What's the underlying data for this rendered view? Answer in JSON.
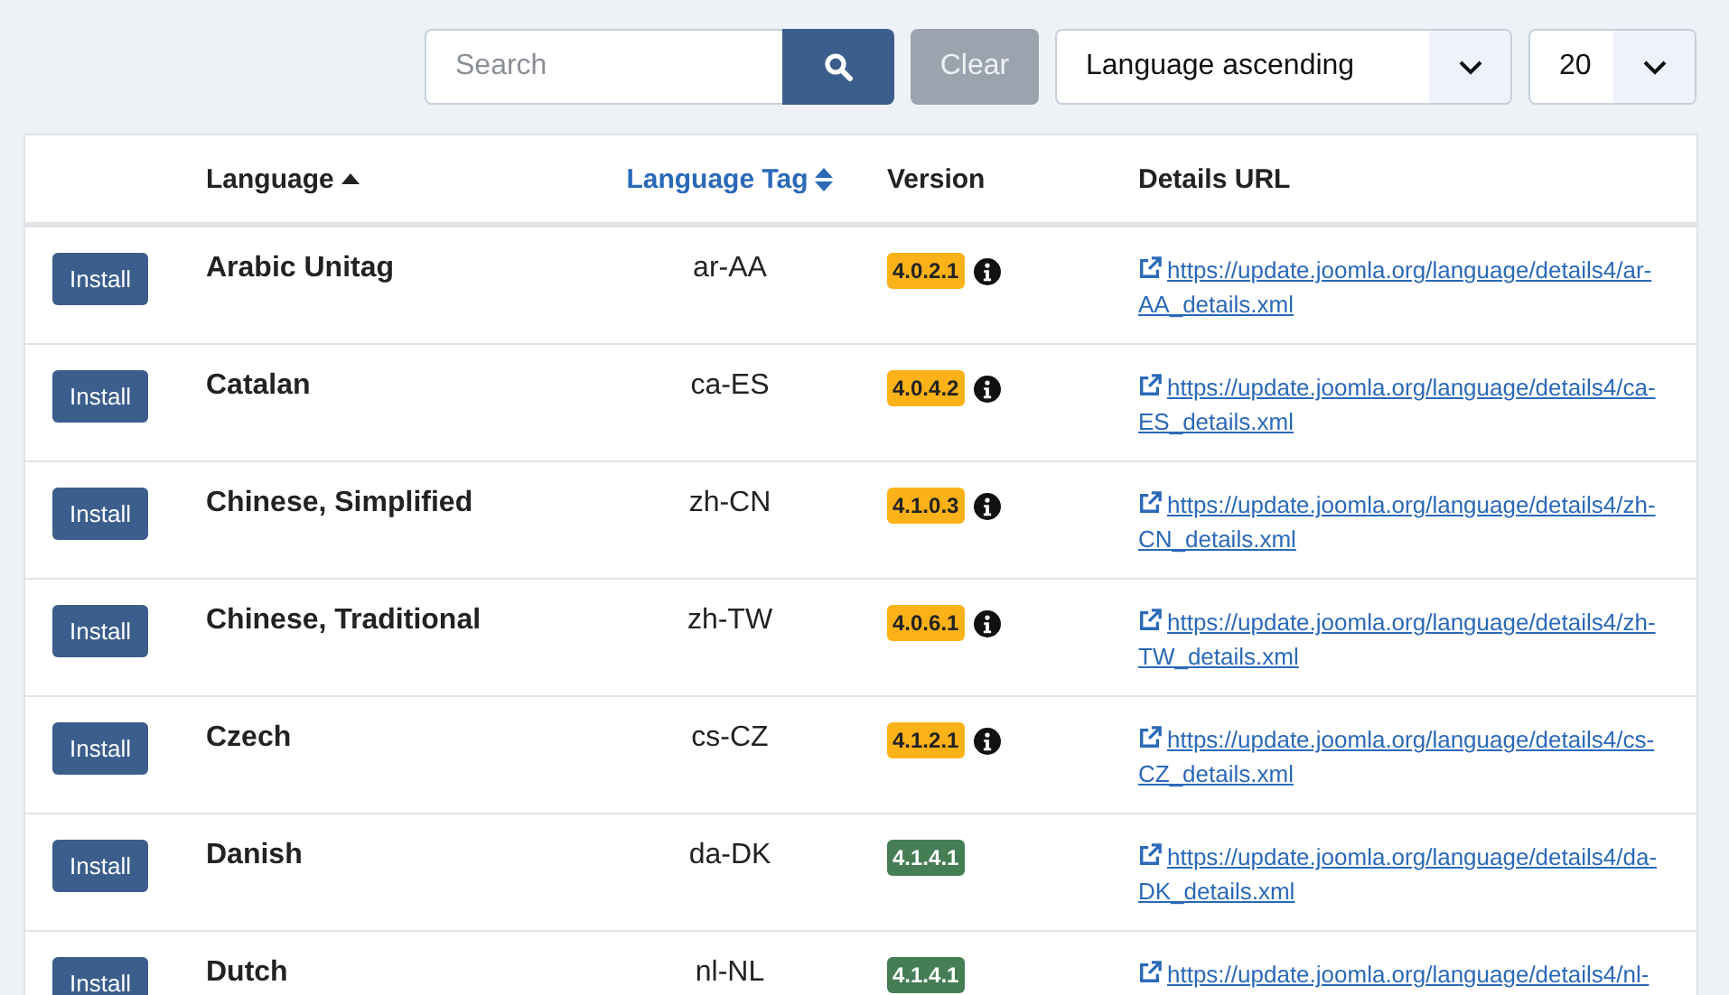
{
  "toolbar": {
    "search": {
      "placeholder": "Search"
    },
    "clear_label": "Clear",
    "sort": {
      "value": "Language ascending"
    },
    "limit": {
      "value": "20"
    }
  },
  "table": {
    "columns": [
      {},
      {
        "label": "Language",
        "sorted_ascending": true,
        "sortable": false
      },
      {
        "label": "Language Tag",
        "sorted_ascending": false,
        "sortable": true
      },
      {
        "label": "Version",
        "sorted_ascending": false,
        "sortable": false
      },
      {
        "label": "Details URL",
        "sorted_ascending": false,
        "sortable": false
      }
    ],
    "rows": [
      {
        "action": "Install",
        "language": "Arabic Unitag",
        "tag": "ar-AA",
        "version": "4.0.2.1",
        "outdated": true,
        "info": true,
        "url": "https://update.joomla.org/language/details4/ar-AA_details.xml"
      },
      {
        "action": "Install",
        "language": "Catalan",
        "tag": "ca-ES",
        "version": "4.0.4.2",
        "outdated": true,
        "info": true,
        "url": "https://update.joomla.org/language/details4/ca-ES_details.xml"
      },
      {
        "action": "Install",
        "language": "Chinese, Simplified",
        "tag": "zh-CN",
        "version": "4.1.0.3",
        "outdated": true,
        "info": true,
        "url": "https://update.joomla.org/language/details4/zh-CN_details.xml"
      },
      {
        "action": "Install",
        "language": "Chinese, Traditional",
        "tag": "zh-TW",
        "version": "4.0.6.1",
        "outdated": true,
        "info": true,
        "url": "https://update.joomla.org/language/details4/zh-TW_details.xml"
      },
      {
        "action": "Install",
        "language": "Czech",
        "tag": "cs-CZ",
        "version": "4.1.2.1",
        "outdated": true,
        "info": true,
        "url": "https://update.joomla.org/language/details4/cs-CZ_details.xml"
      },
      {
        "action": "Install",
        "language": "Danish",
        "tag": "da-DK",
        "version": "4.1.4.1",
        "outdated": false,
        "info": false,
        "url": "https://update.joomla.org/language/details4/da-DK_details.xml"
      },
      {
        "action": "Install",
        "language": "Dutch",
        "tag": "nl-NL",
        "version": "4.1.4.1",
        "outdated": false,
        "info": false,
        "url": "https://update.joomla.org/language/details4/nl-"
      }
    ]
  }
}
